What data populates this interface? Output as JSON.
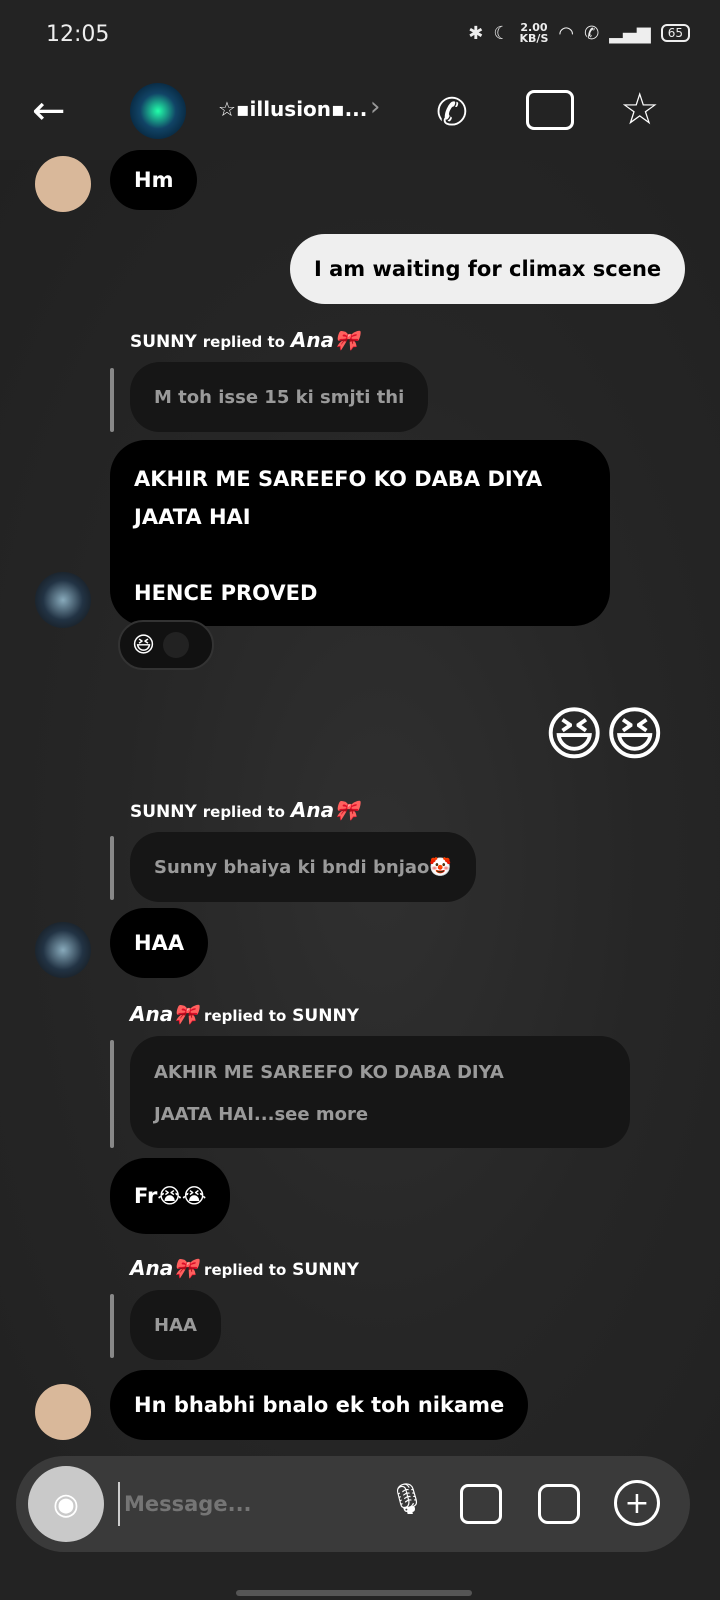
{
  "status": {
    "time": "12:05",
    "net_speed": "2.00",
    "net_unit": "KB/S",
    "battery": "65"
  },
  "header": {
    "title": "☆▪illusion▪...",
    "chevron": "›"
  },
  "messages": {
    "m1": "Hm",
    "m2": "I am waiting for climax scene",
    "r1_label": "replied to",
    "r1_from": "SUNNY",
    "r1_to": "Ana🎀",
    "r1_quote": "M toh isse 15 ki smjti thi",
    "m3a": "AKHIR ME SAREEFO KO DABA DIYA",
    "m3b": "JAATA HAI",
    "m3c": "HENCE PROVED",
    "reaction": "😆",
    "m4": "😆😆",
    "r2_from": "SUNNY",
    "r2_label": "replied to",
    "r2_to": "Ana🎀",
    "r2_quote": "Sunny bhaiya ki bndi bnjao🤡",
    "m5": "HAA",
    "r3_from": "Ana🎀",
    "r3_label": "replied to",
    "r3_to": "SUNNY",
    "r3_quote_a": "AKHIR ME SAREEFO KO DABA DIYA",
    "r3_quote_b": "JAATA HAI...see more",
    "m6": "Fr😭😭",
    "r4_from": "Ana🎀",
    "r4_label": "replied to",
    "r4_to": "SUNNY",
    "r4_quote": "HAA",
    "m7": "Hn bhabhi bnalo ek toh nikame"
  },
  "composer": {
    "placeholder": "Message..."
  }
}
